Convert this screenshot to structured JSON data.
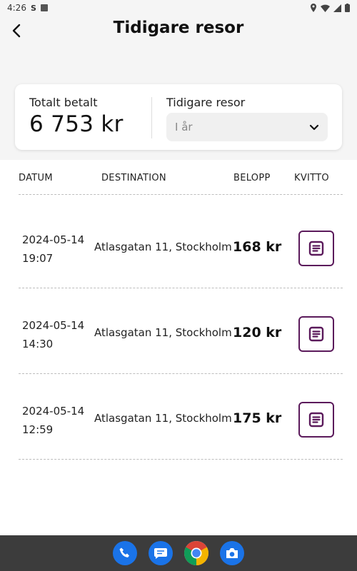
{
  "status": {
    "time": "4:26"
  },
  "header": {
    "title": "Tidigare resor"
  },
  "summary": {
    "total_label": "Totalt betalt",
    "total_value": "6 753 kr",
    "period_label": "Tidigare resor",
    "period_value": "I år"
  },
  "table": {
    "columns": [
      "DATUM",
      "DESTINATION",
      "BELOPP",
      "KVITTO"
    ],
    "rows": [
      {
        "date": "2024-05-14",
        "time": "19:07",
        "destination": "Atlasgatan 11, Stockholm",
        "amount": "168 kr"
      },
      {
        "date": "2024-05-14",
        "time": "14:30",
        "destination": "Atlasgatan 11, Stockholm",
        "amount": "120 kr"
      },
      {
        "date": "2024-05-14",
        "time": "12:59",
        "destination": "Atlasgatan 11, Stockholm",
        "amount": "175 kr"
      }
    ]
  },
  "colors": {
    "accent": "#5b1a5b",
    "receipt_icon": "#5b1a5b",
    "background": "#f5f5f5"
  },
  "icons": {
    "back": "arrow-left-icon",
    "dropdown": "chevron-down-icon",
    "receipt": "receipt-icon",
    "dock": [
      "phone-icon",
      "messages-icon",
      "chrome-icon",
      "camera-icon"
    ]
  }
}
